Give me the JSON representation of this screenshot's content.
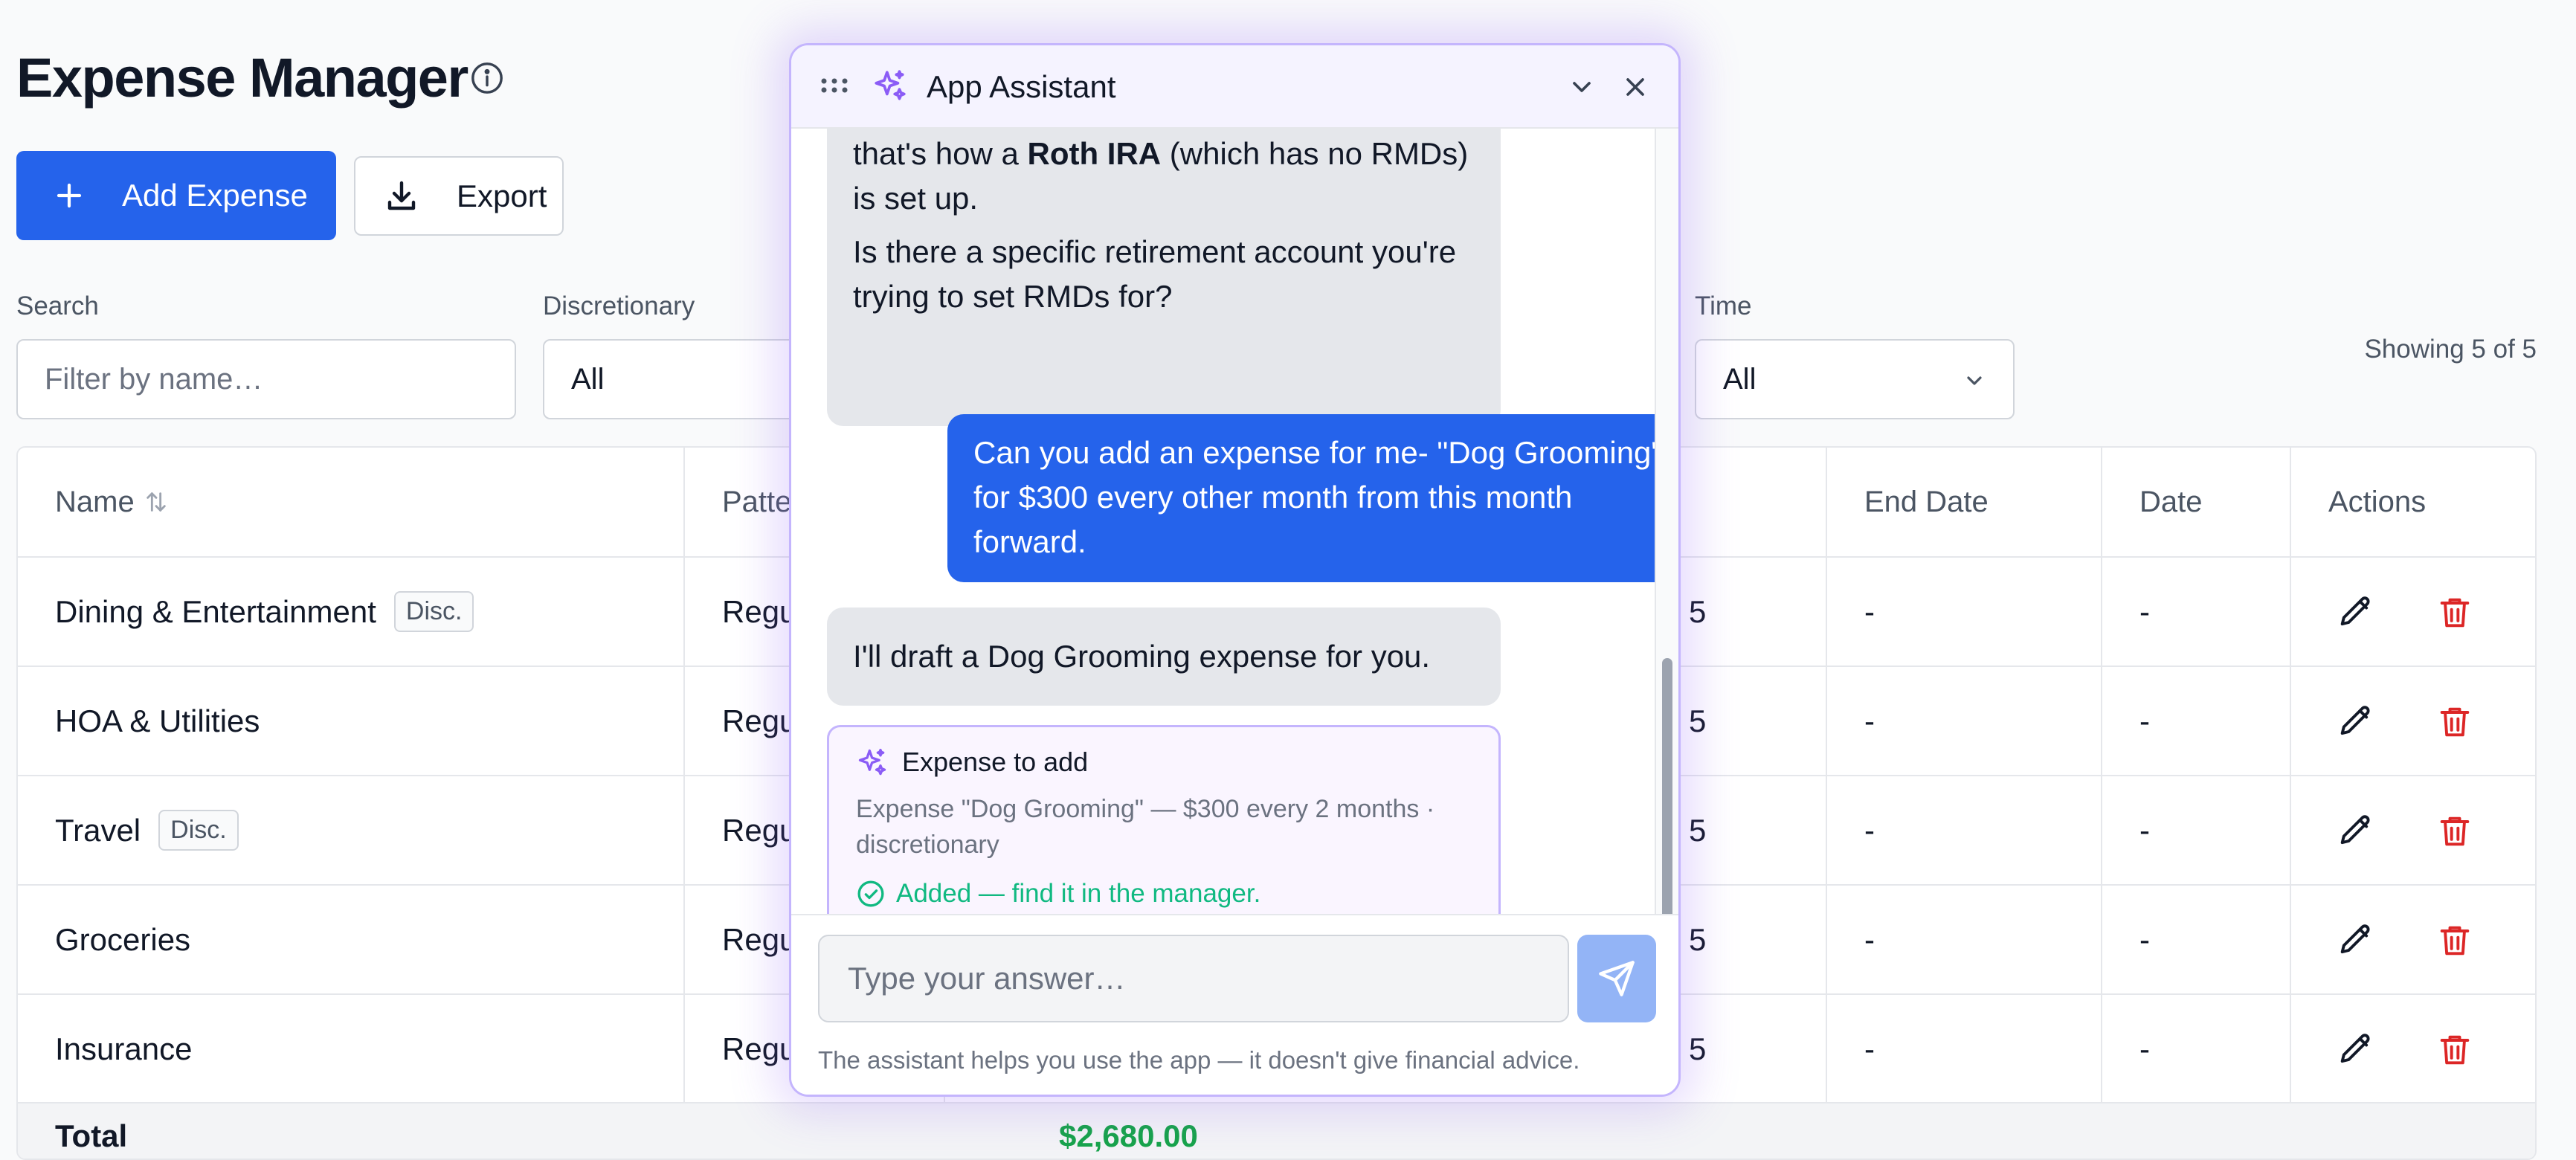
{
  "page": {
    "title": "Expense Manager"
  },
  "toolbar": {
    "add_label": "Add Expense",
    "export_label": "Export"
  },
  "filters": {
    "search_label": "Search",
    "search_placeholder": "Filter by name…",
    "discretionary_label": "Discretionary",
    "discretionary_value": "All",
    "time_label": "Time",
    "time_value": "All"
  },
  "showing_text": "Showing 5 of 5",
  "table": {
    "headers": {
      "name": "Name",
      "pattern": "Patte",
      "end_date": "End Date",
      "date": "Date",
      "actions": "Actions"
    },
    "rows": [
      {
        "name": "Dining & Entertainment",
        "badge": "Disc.",
        "pattern": "Regu",
        "amount_tail": "5",
        "end_date": "-",
        "date": "-"
      },
      {
        "name": "HOA & Utilities",
        "badge": "",
        "pattern": "Regu",
        "amount_tail": "5",
        "end_date": "-",
        "date": "-"
      },
      {
        "name": "Travel",
        "badge": "Disc.",
        "pattern": "Regu",
        "amount_tail": "5",
        "end_date": "-",
        "date": "-"
      },
      {
        "name": "Groceries",
        "badge": "",
        "pattern": "Regu",
        "amount_tail": "5",
        "end_date": "-",
        "date": "-"
      },
      {
        "name": "Insurance",
        "badge": "",
        "pattern": "Regu",
        "amount_tail": "5",
        "end_date": "-",
        "date": "-"
      }
    ],
    "total_label": "Total",
    "total_value": "$2,680.00"
  },
  "assistant": {
    "title": "App Assistant",
    "messages": {
      "bot_1_pre": "that's how a ",
      "bot_1_bold": "Roth IRA",
      "bot_1_post": " (which has no RMDs) is set up.",
      "bot_1_question": "Is there a specific retirement account you're trying to set RMDs for?",
      "user_1": "Can you add an expense for me- \"Dog Grooming\" for $300 every other month from this month forward.",
      "bot_2": "I'll draft a Dog Grooming expense for you."
    },
    "card": {
      "title": "Expense to add",
      "description": "Expense \"Dog Grooming\" — $300 every 2 months · discretionary",
      "status": "Added — find it in the manager."
    },
    "input_placeholder": "Type your answer…",
    "disclaimer": "The assistant helps you use the app — it doesn't give financial advice."
  },
  "colors": {
    "primary": "#2563eb",
    "danger": "#dc2626",
    "success": "#10b981",
    "assistant_accent": "#8b5cf6"
  },
  "icons": [
    "info-icon",
    "plus-icon",
    "download-icon",
    "chevron-down-icon",
    "sort-icon",
    "edit-icon",
    "trash-icon",
    "grip-icon",
    "sparkle-icon",
    "close-icon",
    "check-circle-icon",
    "send-icon"
  ]
}
